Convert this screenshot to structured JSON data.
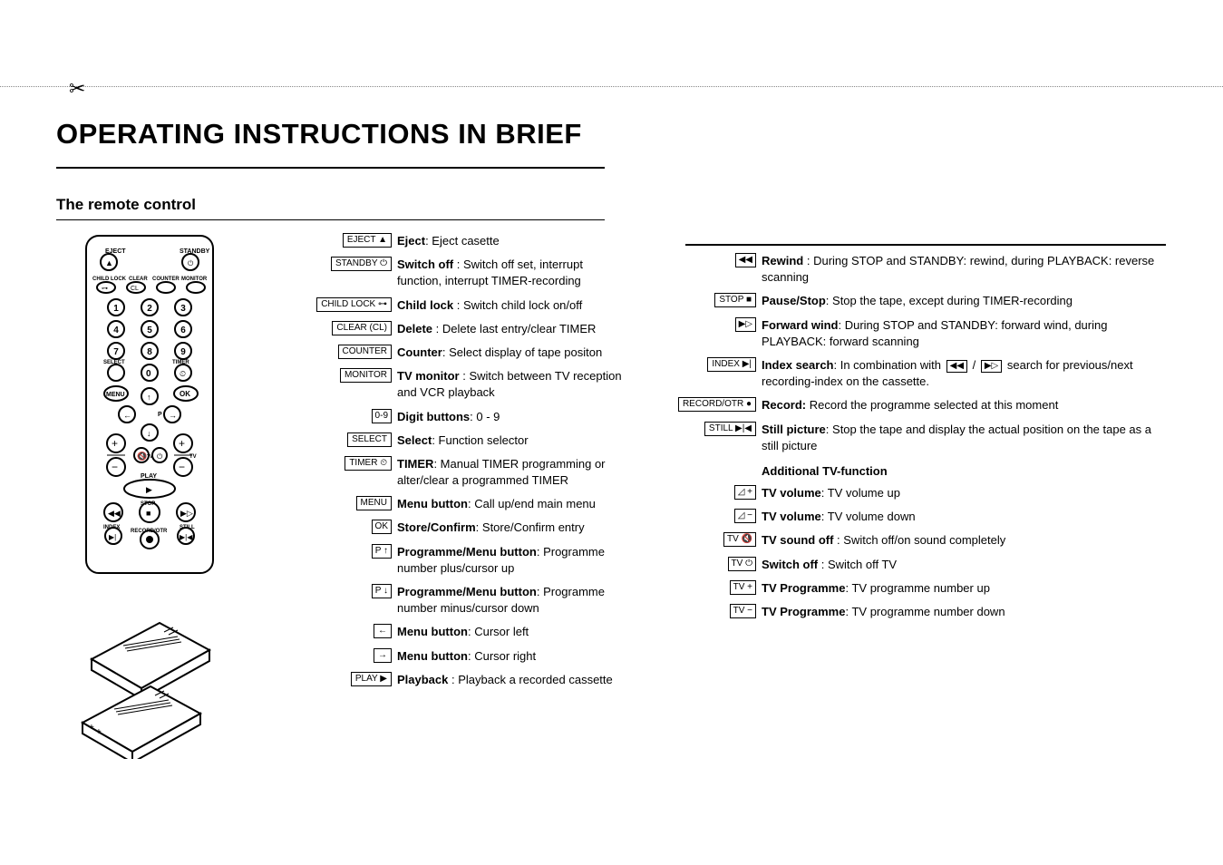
{
  "title": "OPERATING INSTRUCTIONS IN BRIEF",
  "section1": "The remote control",
  "left": {
    "eject_btn": "EJECT ▲",
    "eject": {
      "b": "Eject",
      "t": ": Eject casette"
    },
    "standby_btn": "STANDBY ⏻",
    "standby": {
      "b": "Switch off",
      "t": " : Switch off set, interrupt function, interrupt TIMER-recording"
    },
    "childlock_btn": "CHILD LOCK ⊶",
    "childlock": {
      "b": "Child lock",
      "t": " : Switch child lock on/off"
    },
    "clear_btn": "CLEAR (CL)",
    "clear": {
      "b": "Delete",
      "t": " : Delete last entry/clear TIMER"
    },
    "counter_btn": "COUNTER",
    "counter": {
      "b": "Counter",
      "t": ": Select display of tape positon"
    },
    "monitor_btn": "MONITOR",
    "monitor": {
      "b": "TV monitor",
      "t": " : Switch between TV reception and VCR playback"
    },
    "digits_btn": "0-9",
    "digits": {
      "b": "Digit buttons",
      "t": ": 0 - 9"
    },
    "select_btn": "SELECT",
    "select": {
      "b": "Select",
      "t": ": Function selector"
    },
    "timer_btn": "TIMER ⏲",
    "timer": {
      "b": "TIMER",
      "t": ": Manual TIMER programming or alter/clear a programmed TIMER"
    },
    "menu_btn": "MENU",
    "menu": {
      "b": "Menu button",
      "t": ": Call up/end main menu"
    },
    "ok_btn": "OK",
    "ok": {
      "b": "Store/Confirm",
      "t": ": Store/Confirm entry"
    },
    "pup_btn": "P ↑",
    "pup": {
      "b": "Programme/Menu button",
      "t": ": Programme number plus/cursor up"
    },
    "pdn_btn": "P ↓",
    "pdn": {
      "b": "Programme/Menu button",
      "t": ": Programme number minus/cursor down"
    },
    "left_btn": "←",
    "leftm": {
      "b": "Menu button",
      "t": ": Cursor left"
    },
    "right_btn": "→",
    "rightm": {
      "b": "Menu button",
      "t": ": Cursor right"
    },
    "play_btn": "PLAY ▶",
    "play": {
      "b": "Playback",
      "t": " : Playback a recorded cassette"
    }
  },
  "right": {
    "rew_btn": "◀◀",
    "rew": {
      "b": "Rewind",
      "t": " : During STOP and STANDBY: rewind, during PLAYBACK: reverse scanning"
    },
    "stop_btn": "STOP ■",
    "stop": {
      "b": "Pause/Stop",
      "t": ": Stop the tape, except during TIMER-recording"
    },
    "ff_btn": "▶▷",
    "ff": {
      "b": "Forward wind",
      "t": ": During STOP and STANDBY: forward wind, during PLAYBACK: forward scanning"
    },
    "index_btn": "INDEX ▶|",
    "index": {
      "b": "Index search",
      "t1": ": In combination with ",
      "t2": " / ",
      "t3": " search for previous/next recording-index on the cassette.",
      "i1": "◀◀",
      "i2": "▶▷"
    },
    "record_btn": "RECORD/OTR ●",
    "record": {
      "b": "Record:",
      "t": " Record the programme selected at this moment"
    },
    "still_btn": "STILL ▶|◀",
    "still": {
      "b": "Still picture",
      "t": ": Stop the tape and display the actual position on the tape as a still picture"
    },
    "addl": "Additional TV-function",
    "volu_btn": "◿ +",
    "volu": {
      "b": "TV volume",
      "t": ": TV volume up"
    },
    "vold_btn": "◿ −",
    "vold": {
      "b": "TV volume",
      "t": ": TV volume down"
    },
    "mute_btn": "TV 🔇",
    "mute": {
      "b": "TV sound off",
      "t": " : Switch off/on sound completely"
    },
    "tvoff_btn": "TV ⏻",
    "tvoff": {
      "b": "Switch off",
      "t": " : Switch off TV"
    },
    "tvu_btn": "TV +",
    "tvu": {
      "b": "TV Programme",
      "t": ": TV programme number up"
    },
    "tvd_btn": "TV −",
    "tvd": {
      "b": "TV Programme",
      "t": ": TV programme number down"
    }
  }
}
